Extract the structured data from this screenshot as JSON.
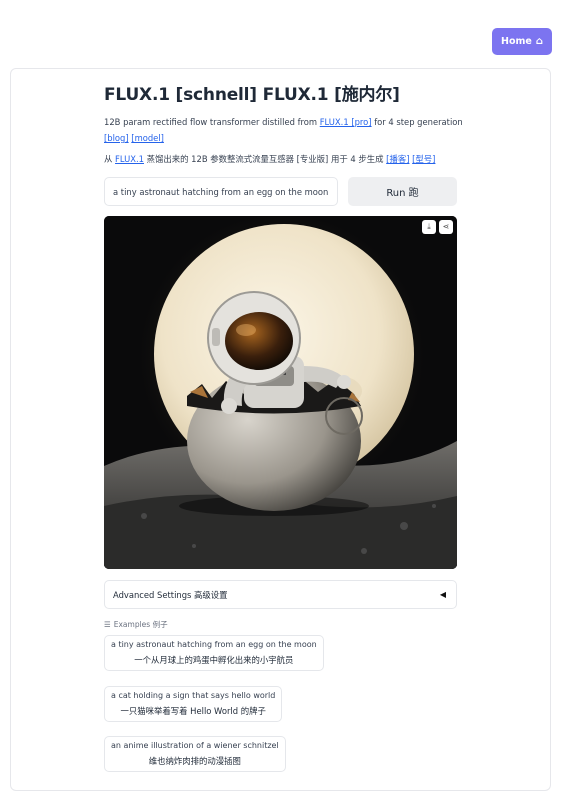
{
  "header": {
    "home_label": "Home",
    "home_icon": "home-icon"
  },
  "title": "FLUX.1 [schnell] FLUX.1 [施内尔]",
  "description_en": {
    "text_before": "12B param rectified flow transformer distilled from ",
    "link_flux": "FLUX.1 [pro]",
    "text_after": " for 4 step generation",
    "link_blog": "[blog]",
    "link_model": "[model]"
  },
  "description_zh": {
    "text_before": "从 ",
    "link_flux": "FLUX.1",
    "text_after": " 蒸馏出来的 12B 参数整流式流量互感器 [专业版] 用于 4 步生成 ",
    "link_blog": "[播客]",
    "link_model": "[型号]"
  },
  "prompt": {
    "value": "a tiny astronaut hatching from an egg on the moon"
  },
  "run_button": {
    "label": "Run 跑"
  },
  "image": {
    "alt": "a tiny astronaut hatching from an egg on the moon",
    "download_icon": "download-icon",
    "share_icon": "share-icon"
  },
  "advanced_settings": {
    "label": "Advanced Settings 高级设置",
    "toggle_icon": "triangle-left-icon"
  },
  "examples": {
    "label": "Examples 例子",
    "items": [
      {
        "en": "a tiny astronaut hatching from an egg on the moon",
        "zh": "一个从月球上的鸡蛋中孵化出来的小宇航员"
      },
      {
        "en": "a cat holding a sign that says hello world",
        "zh": "一只猫咪举着写着 Hello World 的牌子"
      },
      {
        "en": "an anime illustration of a wiener schnitzel",
        "zh": "维也纳炸肉排的动漫插图"
      }
    ]
  },
  "colors": {
    "home_button": "#7c74f0",
    "link": "#2563eb",
    "run_button_bg": "#eeeff1"
  }
}
